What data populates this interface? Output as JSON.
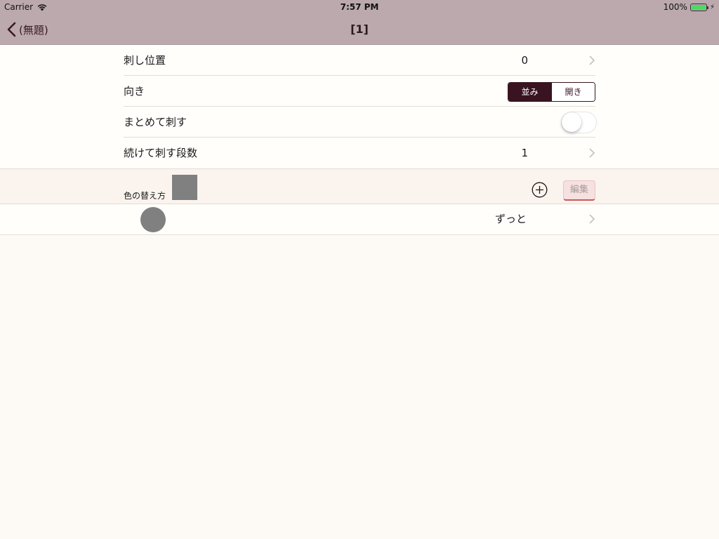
{
  "status_bar": {
    "carrier": "Carrier",
    "time": "7:57 PM",
    "battery": "100%",
    "battery_color": "#4cd964"
  },
  "nav": {
    "back_label": "(無題)",
    "title": "[1]"
  },
  "settings": {
    "stitch_position": {
      "label": "刺し位置",
      "value": "0"
    },
    "direction": {
      "label": "向き",
      "options": [
        "並み",
        "開き"
      ],
      "selected": "並み"
    },
    "bulk_stitch": {
      "label": "まとめて刺す",
      "on": false
    },
    "consecutive_rows": {
      "label": "続けて刺す段数",
      "value": "1"
    }
  },
  "color_section": {
    "label": "色の替え方",
    "swatch_color": "#808080",
    "edit_label": "編集"
  },
  "color_rows": [
    {
      "color": "#808080",
      "value": "ずっと"
    }
  ],
  "colors": {
    "bar_bg": "#bba9ad",
    "accent": "#3a1320",
    "background": "#fdfaf5"
  }
}
